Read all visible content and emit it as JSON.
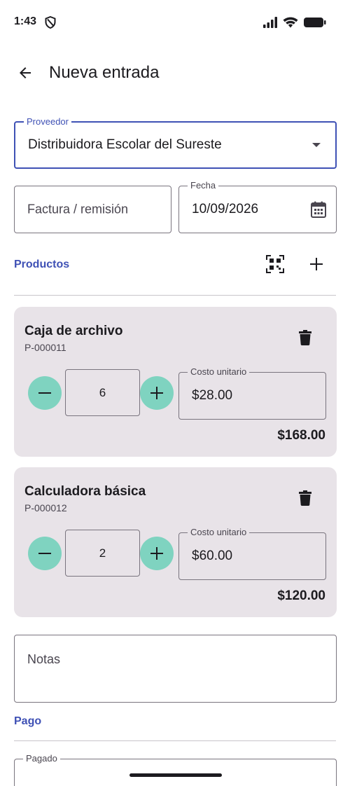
{
  "status": {
    "time": "1:43",
    "icons": [
      "shield-icon",
      "signal-icon",
      "wifi-icon",
      "battery-icon"
    ]
  },
  "header": {
    "title": "Nueva entrada",
    "back_icon": "arrow-back-icon"
  },
  "form": {
    "supplier": {
      "label": "Proveedor",
      "value": "Distribuidora Escolar del Sureste",
      "icon": "dropdown-arrow-icon"
    },
    "invoice": {
      "placeholder": "Factura / remisión"
    },
    "date": {
      "label": "Fecha",
      "value": "10/09/2026",
      "icon": "calendar-icon"
    },
    "notes": {
      "placeholder": "Notas"
    }
  },
  "products": {
    "title": "Productos",
    "scan_icon": "qr-scan-icon",
    "add_icon": "add-icon",
    "items": [
      {
        "name": "Caja de archivo",
        "code": "P-000011",
        "quantity": "6",
        "cost_label": "Costo unitario",
        "cost": "$28.00",
        "total": "$168.00"
      },
      {
        "name": "Calculadora básica",
        "code": "P-000012",
        "quantity": "2",
        "cost_label": "Costo unitario",
        "cost": "$60.00",
        "total": "$120.00"
      }
    ]
  },
  "payment": {
    "title": "Pago",
    "paid_label": "Pagado"
  },
  "colors": {
    "accent": "#3f51b5",
    "card_bg": "#e8e3e8",
    "stepper": "#7fd3c0"
  }
}
